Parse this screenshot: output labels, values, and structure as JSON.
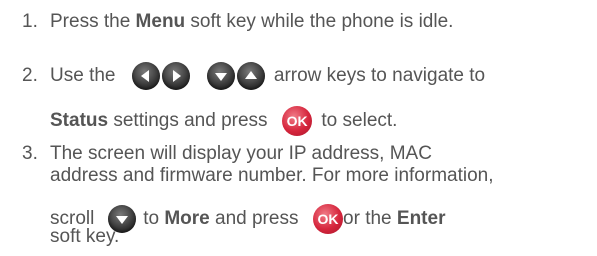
{
  "steps": [
    {
      "number": "1.",
      "text_a": "Press the ",
      "bold_a": "Menu",
      "text_b": " soft key while the phone is idle."
    },
    {
      "number": "2.",
      "line1_a": "Use the",
      "line1_b": "arrow keys to navigate to",
      "line2_bold": "Status",
      "line2_a": " settings and press",
      "ok_label": "OK",
      "line2_b": "to select."
    },
    {
      "number": "3.",
      "line1": "The screen will display your IP address, MAC",
      "line2": "address and firmware number. For more information,",
      "line3_a": "scroll",
      "line3_b": "to ",
      "line3_bold_a": "More",
      "line3_c": " and press",
      "ok_label": "OK",
      "line3_d": "or the ",
      "line3_bold_b": "Enter",
      "line4": "soft key."
    }
  ],
  "icons": {
    "key_color": "#2e2e2e",
    "ok_color": "#d6263d"
  }
}
